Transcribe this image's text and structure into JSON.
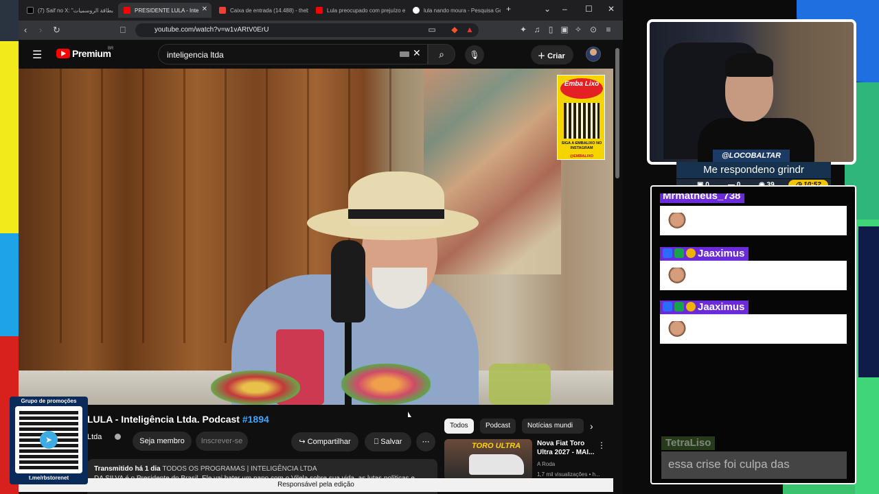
{
  "colors": {
    "yt_red": "#ff0000",
    "link_blue": "#3ea6ff",
    "chat_name_bg": "#6c2bd9",
    "timer_yellow": "#f3c400",
    "stream_bg_green": "#3fd67a",
    "stream_bg_blue": "#1e6fe0",
    "stream_bg_yellow": "#f2ea1b",
    "stream_bg_red": "#d8211c"
  },
  "browser": {
    "tabs": [
      {
        "label": "(7) Saif no X: \"بطاقة الروسميات",
        "icon": "x-logo-icon",
        "active": false
      },
      {
        "label": "PRESIDENTE LULA - Inte",
        "icon": "youtube-icon",
        "active": true
      },
      {
        "label": "Caixa de entrada (14.488) - thebe",
        "icon": "gmail-icon",
        "active": false
      },
      {
        "label": "Lula preocupado com prejuízo e",
        "icon": "youtube-icon",
        "active": false
      },
      {
        "label": "lula nando moura - Pesquisa Go",
        "icon": "google-icon",
        "active": false
      }
    ],
    "new_tab": "+",
    "url": "youtube.com/watch?v=w1vARtV0ErU"
  },
  "youtube": {
    "logo_text": "Premium",
    "logo_region": "BR",
    "search_value": "inteligencia ltda",
    "create_label": "Criar",
    "sponsor": {
      "brand": "Emba Lixo",
      "text": "SIGA A EMBALIXO NO INSTAGRAM",
      "handle": "@EMBALIXO"
    },
    "video_title": "LULA - Inteligência Ltda. Podcast",
    "video_tag": "#1894",
    "channel_name": "Ltda",
    "join_label": "Seja membro",
    "subscribe_label": "Inscrever-se",
    "share_label": "Compartilhar",
    "save_label": "Salvar",
    "more_label": "⋯",
    "desc_meta": "Transmitido há 1 dia",
    "desc_tags": "TODOS OS PROGRAMAS | INTELIGÊNCIA LTDA",
    "desc_body": "DA SILVA é o Presidente do Brasil. Ele vai bater um papo com o Vilela sobre sua vida, as lutas políticas e",
    "chips": [
      "Todos",
      "Podcast",
      "Notícias mundi"
    ],
    "recommendation": {
      "thumb_text": "TORO ULTRA",
      "title": "Nova Fiat Toro Ultra 2027 - MAI...",
      "channel": "A Roda",
      "meta": "1,7 mil visualizações • h..."
    },
    "footer": "Responsável pela edição"
  },
  "promo": {
    "title": "Grupo de promoções",
    "url": "t.me/rbstorenet"
  },
  "stream": {
    "streamer": "@LOCOBALTAR",
    "status": "Me respondeno grindr",
    "stats": {
      "a": "0",
      "b": "0",
      "c": "39",
      "time": "10:52"
    }
  },
  "chat": {
    "messages": [
      {
        "user": "Mrmatheus_738"
      },
      {
        "user": "Jaaximus"
      },
      {
        "user": "Jaaximus"
      }
    ],
    "ghost_user": "TetraLiso",
    "ghost_message": "essa crise foi culpa das"
  }
}
